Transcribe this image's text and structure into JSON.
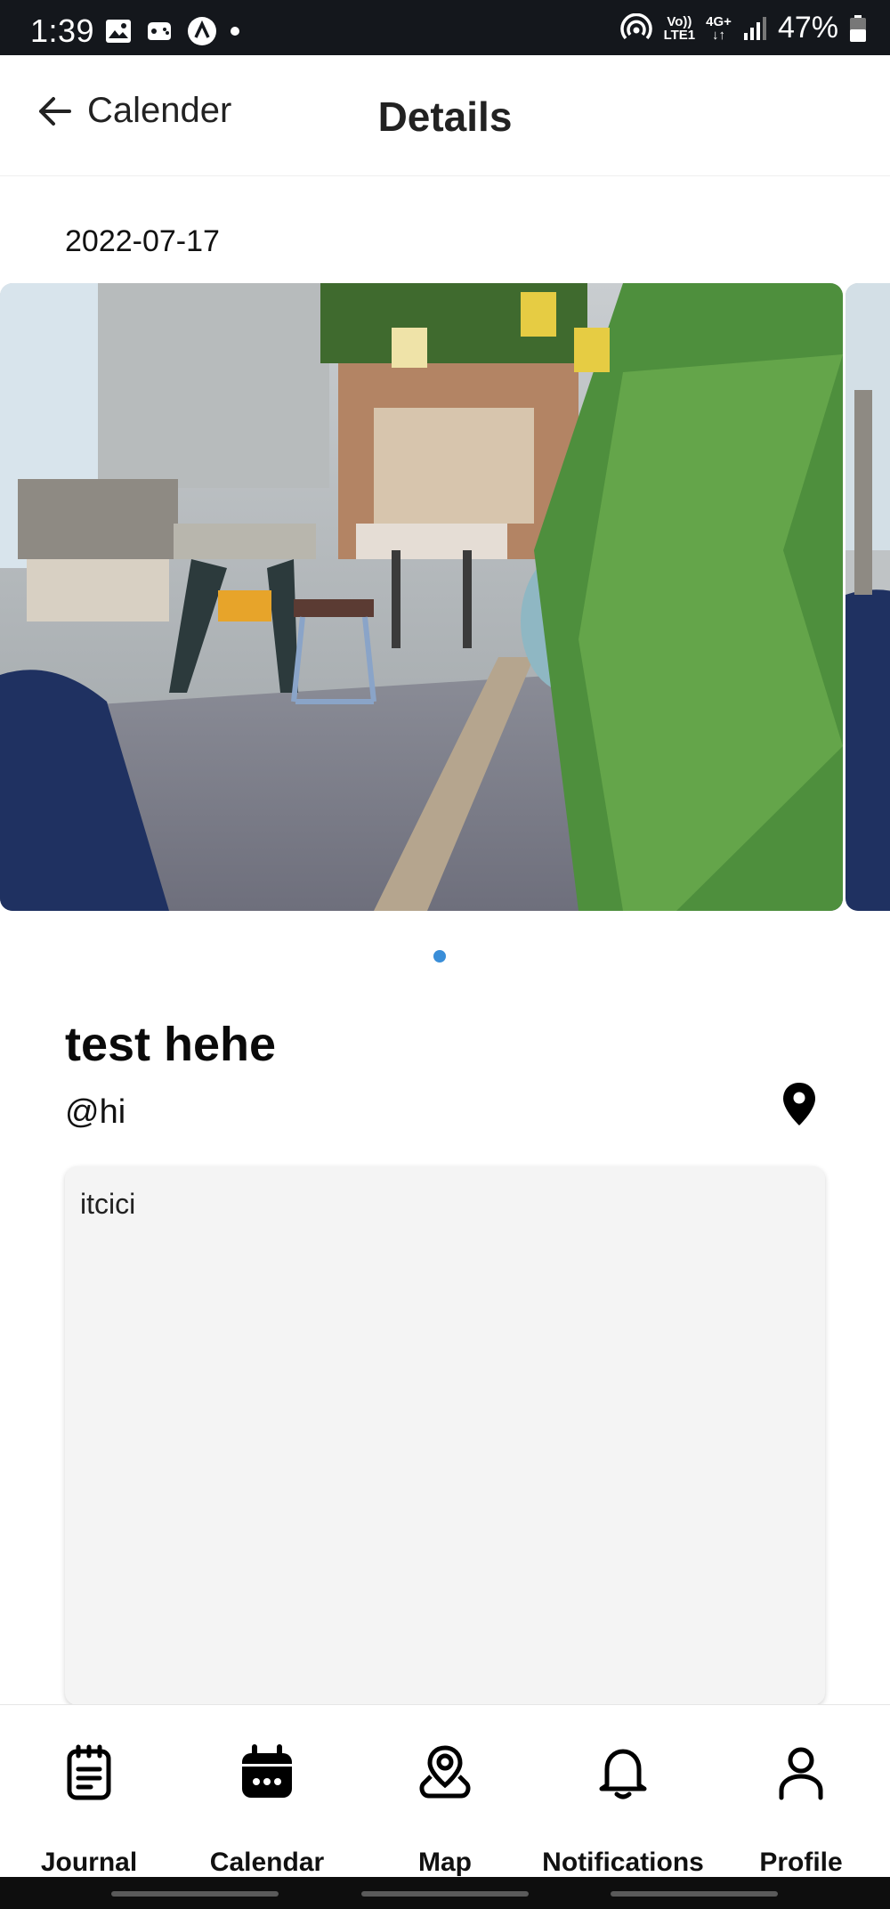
{
  "status_bar": {
    "time": "1:39",
    "net_line1": "Vo))",
    "net_line2": "LTE1",
    "net_type": "4G+",
    "battery": "47%"
  },
  "header": {
    "back_label": "Calender",
    "title": "Details"
  },
  "entry": {
    "date": "2022-07-17",
    "title": "test hehe",
    "user": "@hi",
    "note": "itcici",
    "photo_count": 1,
    "active_photo": 1
  },
  "bottom_nav": {
    "items": [
      {
        "label": "Journal",
        "icon": "journal-icon"
      },
      {
        "label": "Calendar",
        "icon": "calendar-icon"
      },
      {
        "label": "Map",
        "icon": "map-pin-icon"
      },
      {
        "label": "Notifications",
        "icon": "bell-icon"
      },
      {
        "label": "Profile",
        "icon": "profile-icon"
      }
    ]
  },
  "colors": {
    "accent": "#3a8ed8",
    "status_bar": "#14171c",
    "note_bg": "#f4f4f4"
  }
}
